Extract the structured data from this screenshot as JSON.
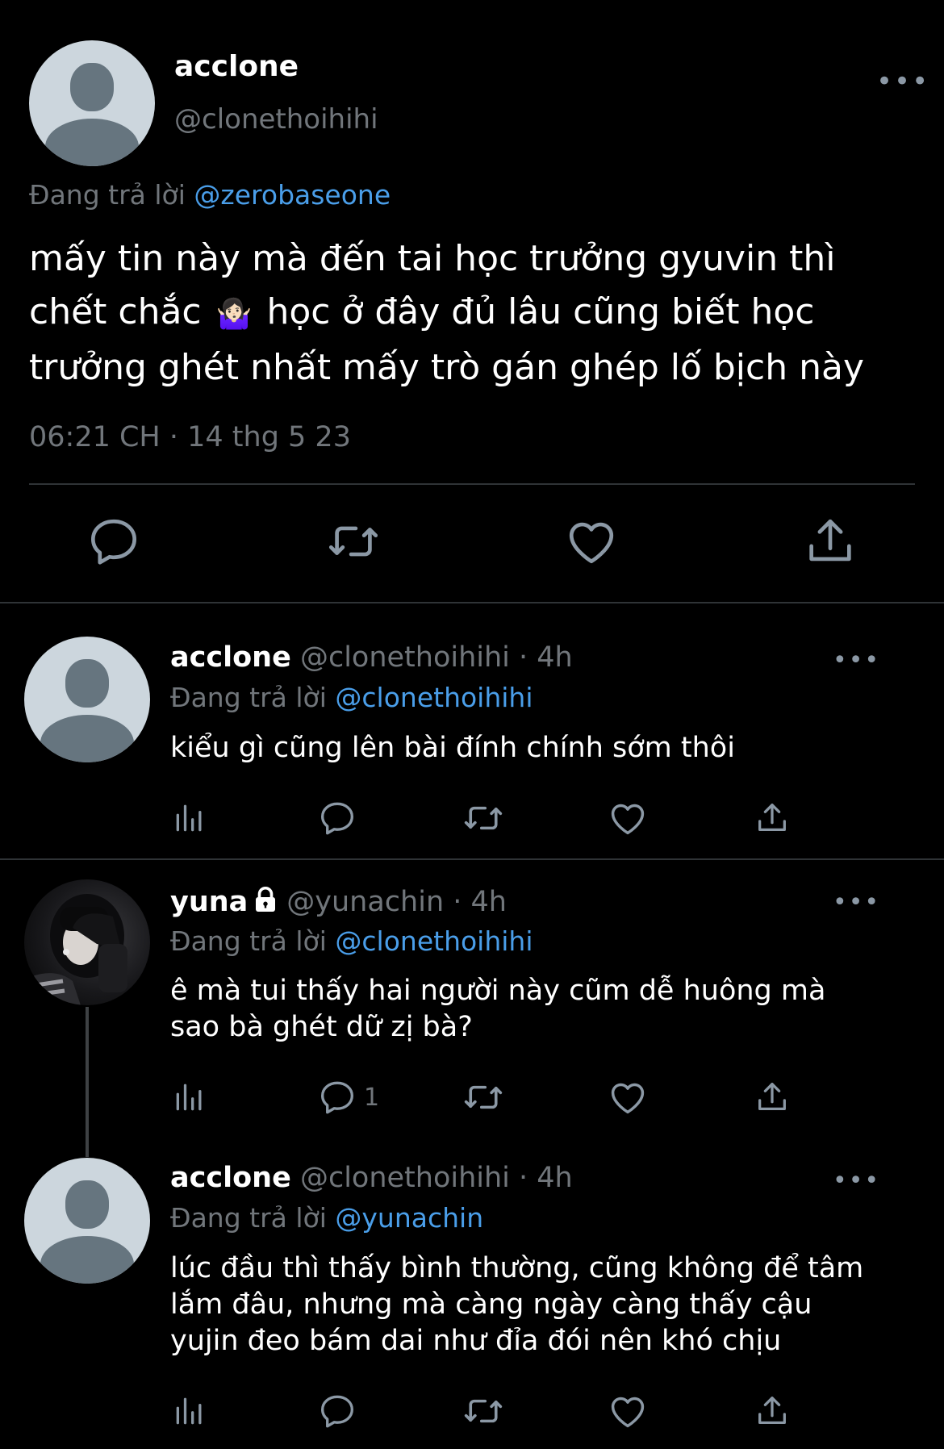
{
  "main_tweet": {
    "display_name": "acclone",
    "handle": "@clonethoihihi",
    "replying_prefix": "Đang trả lời",
    "replying_to": "@zerobaseone",
    "text_line1": "mấy tin này mà đến tai học trưởng gyuvin thì",
    "text_line2_a": "chết chắc",
    "emoji": "🤷🏻‍♀️",
    "text_line2_b": " học ở đây đủ lâu cũng biết học",
    "text_line3": "trưởng ghét nhất mấy trò gán ghép lố bịch này",
    "timestamp": "06:21 CH · 14 thg 5 23",
    "more_label": "•••",
    "actions": [
      "reply-icon",
      "retweet-icon",
      "like-icon",
      "share-icon"
    ]
  },
  "replies": [
    {
      "display_name": "acclone",
      "handle_time": "@clonethoihihi · 4h",
      "replying_prefix": "Đang trả lời",
      "replying_to": "@clonethoihihi",
      "text": "kiểu gì cũng lên bài đính chính sớm thôi",
      "reply_count": "",
      "more_label": "•••"
    },
    {
      "display_name": "yuna",
      "handle_time": "@yunachin · 4h",
      "replying_prefix": "Đang trả lời",
      "replying_to": "@clonethoihihi",
      "text_line1": "ê mà tui thấy hai người này cũm dễ huông mà",
      "text_line2": "sao bà ghét dữ zị bà?",
      "reply_count": "1",
      "protected": true,
      "more_label": "•••"
    },
    {
      "display_name": "acclone",
      "handle_time": "@clonethoihihi · 4h",
      "replying_prefix": "Đang trả lời",
      "replying_to": "@yunachin",
      "text_line1": "lúc đầu thì thấy bình thường, cũng không để tâm",
      "text_line2": "lắm đâu, nhưng mà càng ngày càng thấy cậu",
      "text_line3": "yujin đeo bám dai như đỉa đói nên khó chịu",
      "reply_count": "",
      "more_label": "•••"
    }
  ],
  "colors": {
    "background": "#000000",
    "text": "#ffffff",
    "secondary": "#71767b",
    "link": "#4a9ee9",
    "icon": "#8b98a5",
    "avatar_bg": "#ccd6dd",
    "avatar_fg": "#66757f"
  }
}
